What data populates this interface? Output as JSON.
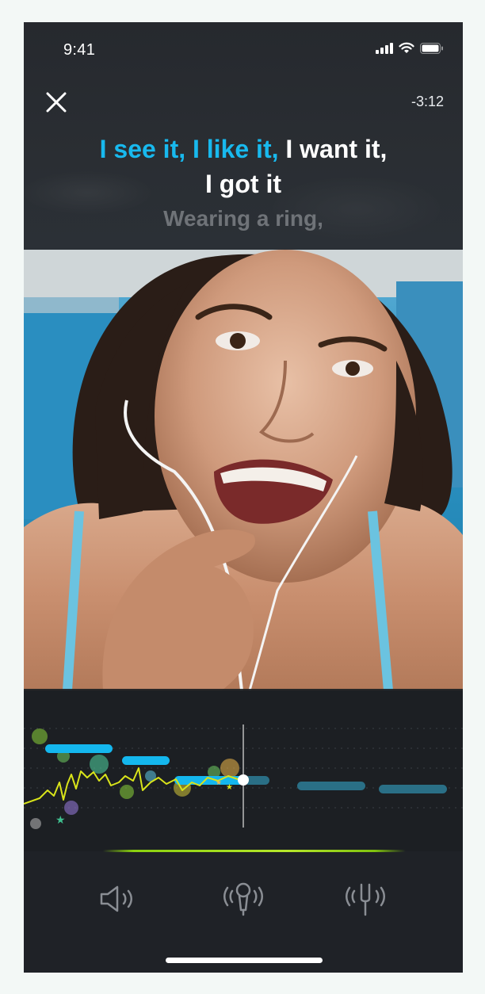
{
  "status_bar": {
    "time": "9:41",
    "icons": [
      "signal-icon",
      "wifi-icon",
      "battery-icon"
    ]
  },
  "header": {
    "close_icon": "close-icon",
    "remaining_time": "-3:12"
  },
  "lyrics": {
    "current_sung": "I see it, I like it,",
    "current_unsung": " I want it,",
    "current_line2": "I got it",
    "next_line": "Wearing a ring,"
  },
  "colors": {
    "sung": "#18b9ee",
    "unsung": "#ffffff",
    "next": "#6f7378",
    "pitch_voice": "#d9e41a",
    "note_past": "#14b7ee",
    "note_future": "#2a6f86",
    "progress": "#8ad10f"
  },
  "pitch_track": {
    "notes_past": 3,
    "notes_future": 3
  },
  "controls": [
    {
      "name": "volume-button",
      "icon": "speaker-icon"
    },
    {
      "name": "microphone-button",
      "icon": "microphone-icon"
    },
    {
      "name": "tuning-fork-button",
      "icon": "tuning-fork-icon"
    }
  ]
}
